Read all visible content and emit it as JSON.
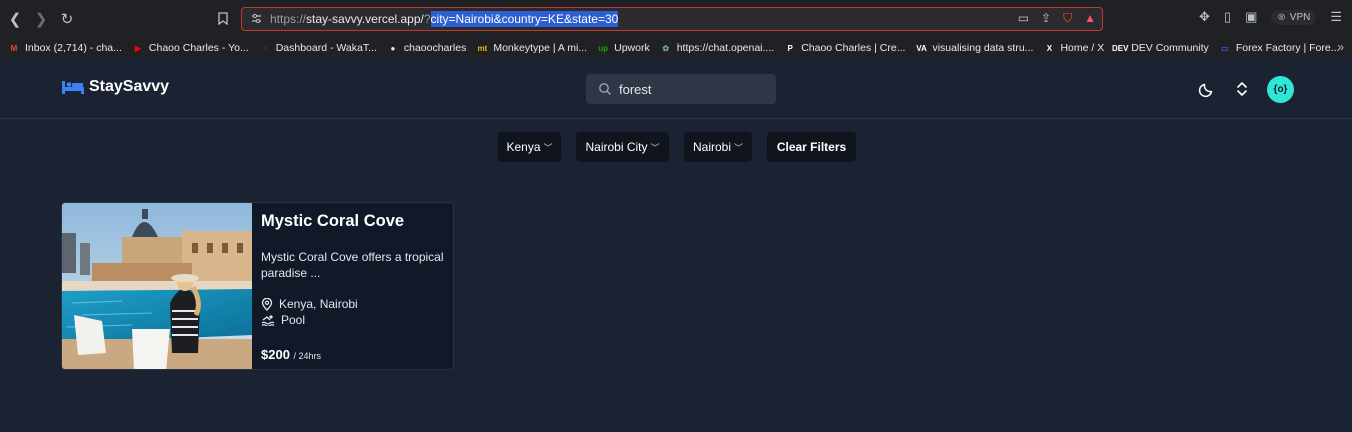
{
  "browser": {
    "url_base_prefix": "https://",
    "url_host": "stay-savvy.vercel.app/",
    "url_q": "?",
    "url_selected": "city=Nairobi&country=KE&state=30",
    "vpn_label": "VPN",
    "brave_badge": "2"
  },
  "bookmarks": [
    {
      "label": "Inbox (2,714) - cha...",
      "icon": "gmail-icon",
      "color": "#ea4335",
      "glyph": "M"
    },
    {
      "label": "Chaoo Charles - Yo...",
      "icon": "youtube-icon",
      "color": "#ff0000",
      "glyph": "▶"
    },
    {
      "label": "Dashboard - WakaT...",
      "icon": "wakatime-icon",
      "color": "#444444",
      "glyph": "◔"
    },
    {
      "label": "chaoocharles",
      "icon": "github-icon",
      "color": "#e8eaed",
      "glyph": "●"
    },
    {
      "label": "Monkeytype | A mi...",
      "icon": "monkeytype-icon",
      "color": "#e2b714",
      "glyph": "mt"
    },
    {
      "label": "Upwork",
      "icon": "upwork-icon",
      "color": "#14a800",
      "glyph": "up"
    },
    {
      "label": "https://chat.openai....",
      "icon": "openai-icon",
      "color": "#74aa9c",
      "glyph": "✿"
    },
    {
      "label": "Chaoo Charles | Cre...",
      "icon": "patreon-icon",
      "color": "#ffffff",
      "glyph": "P"
    },
    {
      "label": "visualising data stru...",
      "icon": "visualgo-icon",
      "color": "#ffffff",
      "glyph": "VA"
    },
    {
      "label": "Home / X",
      "icon": "x-icon",
      "color": "#ffffff",
      "glyph": "X"
    },
    {
      "label": "DEV Community",
      "icon": "dev-icon",
      "color": "#ffffff",
      "glyph": "DEV"
    },
    {
      "label": "Forex Factory | Fore...",
      "icon": "forexfactory-icon",
      "color": "#3b5bdb",
      "glyph": "▭"
    }
  ],
  "app": {
    "logo_text": "StaySavvy",
    "search_value": "forest",
    "avatar_text": "{o}"
  },
  "filters": {
    "country": "Kenya",
    "city": "Nairobi City",
    "state": "Nairobi",
    "clear": "Clear Filters"
  },
  "listing": {
    "title": "Mystic Coral Cove",
    "description": "Mystic Coral Cove offers a tropical paradise ...",
    "location": "Kenya, Nairobi",
    "amenity": "Pool",
    "price": "$200",
    "per": "/ 24hrs"
  },
  "colors": {
    "background": "#1b2332",
    "accent": "#2ee6d6",
    "url_highlight": "#2d5fd3"
  }
}
